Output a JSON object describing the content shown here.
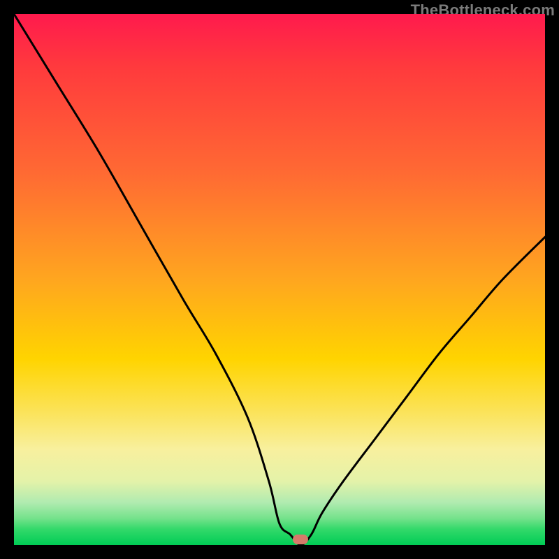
{
  "watermark": {
    "text": "TheBottleneck.com"
  },
  "chart_data": {
    "type": "line",
    "title": "",
    "xlabel": "",
    "ylabel": "",
    "xlim": [
      0,
      100
    ],
    "ylim": [
      0,
      100
    ],
    "grid": false,
    "legend": false,
    "background_gradient": {
      "direction": "vertical",
      "stops": [
        {
          "pos": 0,
          "color": "#ff1a4d"
        },
        {
          "pos": 10,
          "color": "#ff3a3d"
        },
        {
          "pos": 30,
          "color": "#ff6a33"
        },
        {
          "pos": 50,
          "color": "#ffa61f"
        },
        {
          "pos": 65,
          "color": "#ffd400"
        },
        {
          "pos": 75,
          "color": "#fbe35a"
        },
        {
          "pos": 82,
          "color": "#f8f09e"
        },
        {
          "pos": 88,
          "color": "#e4f2a9"
        },
        {
          "pos": 92,
          "color": "#b0ebb0"
        },
        {
          "pos": 95,
          "color": "#74e28b"
        },
        {
          "pos": 97,
          "color": "#33d96a"
        },
        {
          "pos": 100,
          "color": "#00cc55"
        }
      ]
    },
    "series": [
      {
        "name": "bottleneck-curve",
        "color": "#000000",
        "x": [
          0,
          8,
          16,
          24,
          32,
          38,
          44,
          48,
          50,
          52,
          54,
          56,
          58,
          62,
          68,
          74,
          80,
          86,
          92,
          100
        ],
        "y": [
          100,
          87,
          74,
          60,
          46,
          36,
          24,
          12,
          4,
          2,
          0,
          2,
          6,
          12,
          20,
          28,
          36,
          43,
          50,
          58
        ]
      }
    ],
    "marker": {
      "name": "optimal-point",
      "x": 54,
      "y": 1,
      "color": "#d67a6a",
      "shape": "rounded-rect"
    }
  }
}
